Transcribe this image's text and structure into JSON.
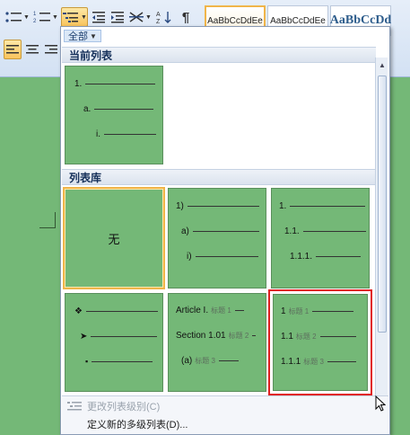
{
  "ribbon": {
    "styles": [
      "AaBbCcDdEe",
      "AaBbCcDdEe",
      "AaBbCcDd"
    ]
  },
  "dropdown": {
    "filter_label": "全部",
    "section_current": "当前列表",
    "section_library": "列表库",
    "current_list": [
      "1.",
      "a.",
      "i."
    ],
    "none_label": "无",
    "tile_paren": [
      "1)",
      "a)",
      "i)"
    ],
    "tile_decimal": [
      "1.",
      "1.1.",
      "1.1.1."
    ],
    "tile_bullets": [
      "❖",
      "➤",
      "▪"
    ],
    "tile_article": [
      {
        "label": "Article I.",
        "sub": "标题 1"
      },
      {
        "label": "Section 1.01",
        "sub": "标题 2"
      },
      {
        "label": "(a)",
        "sub": "标题 3"
      }
    ],
    "tile_heading": [
      {
        "label": "1",
        "sub": "标题 1"
      },
      {
        "label": "1.1",
        "sub": "标题 2"
      },
      {
        "label": "1.1.1",
        "sub": "标题 3"
      }
    ],
    "footer": {
      "change_level": "更改列表级别(C)",
      "define_new": "定义新的多级列表(D)..."
    }
  }
}
